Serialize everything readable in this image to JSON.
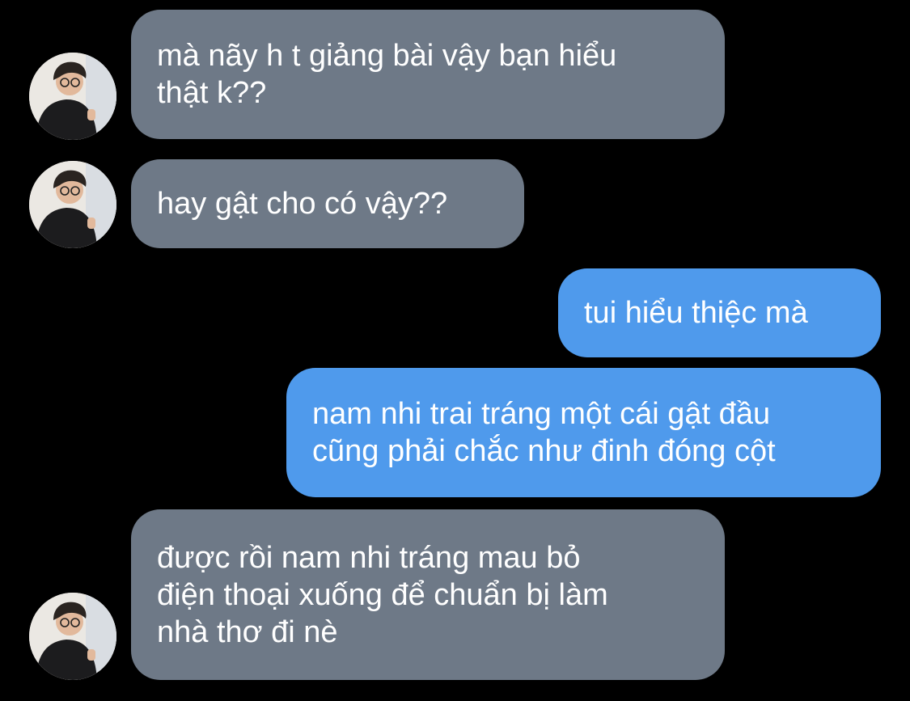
{
  "messages": [
    {
      "id": "m1",
      "direction": "received",
      "text": "mà nãy h t giảng bài vậy bạn hiểu\nthật k??"
    },
    {
      "id": "m2",
      "direction": "received",
      "text": "hay gật cho có vậy??"
    },
    {
      "id": "m3",
      "direction": "sent",
      "text": "tui hiểu thiệc mà"
    },
    {
      "id": "m4",
      "direction": "sent",
      "text": "nam nhi trai tráng một cái gật đầu\ncũng phải chắc như đinh đóng cột"
    },
    {
      "id": "m5",
      "direction": "received",
      "text": "được rồi nam nhi tráng mau bỏ\nđiện thoại xuống để chuẩn bị làm\nnhà thơ đi nè"
    }
  ],
  "colors": {
    "background": "#000000",
    "received_bubble": "#6e7987",
    "sent_bubble": "#4f9aec",
    "text": "#ffffff"
  },
  "icons": {
    "avatar": "contact-avatar-photo"
  }
}
